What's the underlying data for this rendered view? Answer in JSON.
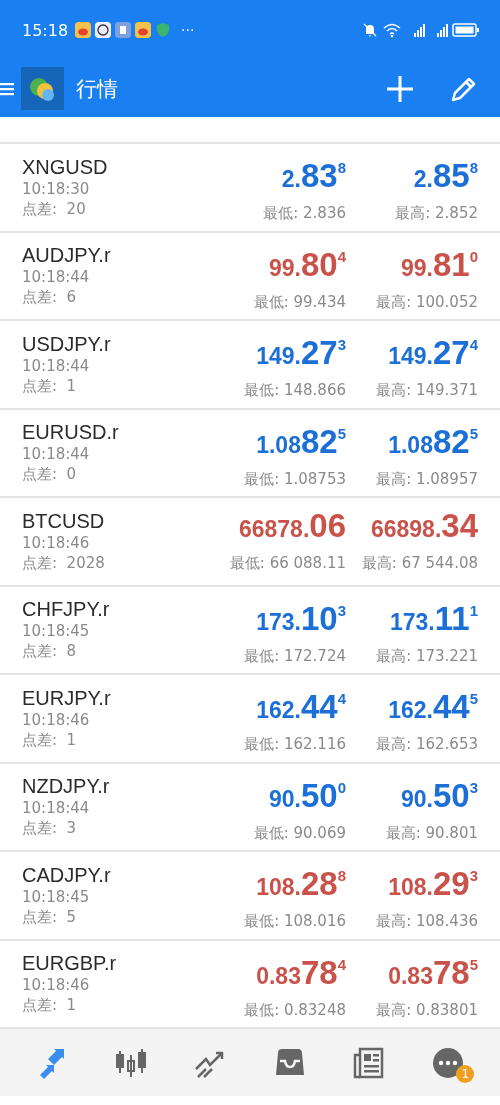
{
  "status_bar": {
    "time": "15:18",
    "more": "···"
  },
  "toolbar": {
    "title": "行情"
  },
  "quotes": [
    {
      "symbol": "XNGUSD",
      "time": "10:18:30",
      "spread": "点差:  20",
      "bid": {
        "prefix": "2.",
        "big": "83",
        "sup": "8",
        "color": "#1b6fd6"
      },
      "ask": {
        "prefix": "2.",
        "big": "85",
        "sup": "8",
        "color": "#1b6fd6"
      },
      "low": "最低: 2.836",
      "high": "最高: 2.852"
    },
    {
      "symbol": "AUDJPY.r",
      "time": "10:18:44",
      "spread": "点差:  6",
      "bid": {
        "prefix": "99.",
        "big": "80",
        "sup": "4",
        "color": "#c9524a"
      },
      "ask": {
        "prefix": "99.",
        "big": "81",
        "sup": "0",
        "color": "#c9524a"
      },
      "low": "最低: 99.434",
      "high": "最高: 100.052"
    },
    {
      "symbol": "USDJPY.r",
      "time": "10:18:44",
      "spread": "点差:  1",
      "bid": {
        "prefix": "149.",
        "big": "27",
        "sup": "3",
        "color": "#1b6fd6"
      },
      "ask": {
        "prefix": "149.",
        "big": "27",
        "sup": "4",
        "color": "#1b6fd6"
      },
      "low": "最低: 148.866",
      "high": "最高: 149.371"
    },
    {
      "symbol": "EURUSD.r",
      "time": "10:18:44",
      "spread": "点差:  0",
      "bid": {
        "prefix": "1.08",
        "big": "82",
        "sup": "5",
        "color": "#1b6fd6"
      },
      "ask": {
        "prefix": "1.08",
        "big": "82",
        "sup": "5",
        "color": "#1b6fd6"
      },
      "low": "最低: 1.08753",
      "high": "最高: 1.08957"
    },
    {
      "symbol": "BTCUSD",
      "time": "10:18:46",
      "spread": "点差:  2028",
      "bid": {
        "prefix": "66878.",
        "big": "06",
        "color": "#c9524a"
      },
      "ask": {
        "prefix": "66898.",
        "big": "34",
        "color": "#c9524a"
      },
      "low": "最低: 66 088.11",
      "high": "最高: 67 544.08"
    },
    {
      "symbol": "CHFJPY.r",
      "time": "10:18:45",
      "spread": "点差:  8",
      "bid": {
        "prefix": "173.",
        "big": "10",
        "sup": "3",
        "color": "#1b6fd6"
      },
      "ask": {
        "prefix": "173.",
        "big": "11",
        "sup": "1",
        "color": "#1b6fd6"
      },
      "low": "最低: 172.724",
      "high": "最高: 173.221"
    },
    {
      "symbol": "EURJPY.r",
      "time": "10:18:46",
      "spread": "点差:  1",
      "bid": {
        "prefix": "162.",
        "big": "44",
        "sup": "4",
        "color": "#1b6fd6"
      },
      "ask": {
        "prefix": "162.",
        "big": "44",
        "sup": "5",
        "color": "#1b6fd6"
      },
      "low": "最低: 162.116",
      "high": "最高: 162.653"
    },
    {
      "symbol": "NZDJPY.r",
      "time": "10:18:44",
      "spread": "点差:  3",
      "bid": {
        "prefix": "90.",
        "big": "50",
        "sup": "0",
        "color": "#1b6fd6"
      },
      "ask": {
        "prefix": "90.",
        "big": "50",
        "sup": "3",
        "color": "#1b6fd6"
      },
      "low": "最低: 90.069",
      "high": "最高: 90.801"
    },
    {
      "symbol": "CADJPY.r",
      "time": "10:18:45",
      "spread": "点差:  5",
      "bid": {
        "prefix": "108.",
        "big": "28",
        "sup": "8",
        "color": "#c9524a"
      },
      "ask": {
        "prefix": "108.",
        "big": "29",
        "sup": "3",
        "color": "#c9524a"
      },
      "low": "最低: 108.016",
      "high": "最高: 108.436"
    },
    {
      "symbol": "EURGBP.r",
      "time": "10:18:46",
      "spread": "点差:  1",
      "bid": {
        "prefix": "0.83",
        "big": "78",
        "sup": "4",
        "color": "#c9524a"
      },
      "ask": {
        "prefix": "0.83",
        "big": "78",
        "sup": "5",
        "color": "#c9524a"
      },
      "low": "最低: 0.83248",
      "high": "最高: 0.83801"
    }
  ],
  "nav": [
    {
      "kind": "quotes",
      "selected": true
    },
    {
      "kind": "chart",
      "selected": false
    },
    {
      "kind": "trade",
      "selected": false
    },
    {
      "kind": "history",
      "selected": false
    },
    {
      "kind": "news",
      "selected": false
    },
    {
      "kind": "messages",
      "selected": false,
      "badge": "1"
    }
  ]
}
